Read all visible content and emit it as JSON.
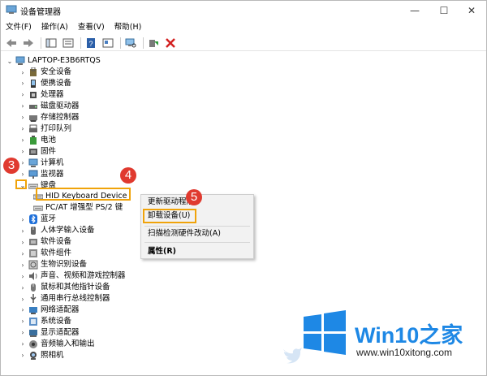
{
  "window": {
    "title": "设备管理器",
    "minimize": "—",
    "maximize": "☐",
    "close": "✕"
  },
  "menu": [
    "文件(F)",
    "操作(A)",
    "查看(V)",
    "帮助(H)"
  ],
  "tree": {
    "root": "LAPTOP-E3B6RTQS",
    "items": [
      {
        "label": "安全设备",
        "icon": "security-icon",
        "expanded": false
      },
      {
        "label": "便携设备",
        "icon": "portable-device-icon",
        "expanded": false
      },
      {
        "label": "处理器",
        "icon": "processor-icon",
        "expanded": false
      },
      {
        "label": "磁盘驱动器",
        "icon": "disk-icon",
        "expanded": false
      },
      {
        "label": "存储控制器",
        "icon": "storage-controller-icon",
        "expanded": false
      },
      {
        "label": "打印队列",
        "icon": "printer-icon",
        "expanded": false
      },
      {
        "label": "电池",
        "icon": "battery-icon",
        "expanded": false
      },
      {
        "label": "固件",
        "icon": "firmware-icon",
        "expanded": false
      },
      {
        "label": "计算机",
        "icon": "computer-icon",
        "expanded": false
      },
      {
        "label": "监视器",
        "icon": "monitor-icon",
        "expanded": false
      },
      {
        "label": "键盘",
        "icon": "keyboard-icon",
        "expanded": true
      },
      {
        "label": "HID Keyboard Device",
        "icon": "keyboard-icon",
        "child": true,
        "selected": true
      },
      {
        "label": "PC/AT 增强型 PS/2 键",
        "icon": "keyboard-icon",
        "child": true
      },
      {
        "label": "蓝牙",
        "icon": "bluetooth-icon",
        "expanded": false
      },
      {
        "label": "人体学输入设备",
        "icon": "hid-icon",
        "expanded": false
      },
      {
        "label": "软件设备",
        "icon": "software-device-icon",
        "expanded": false
      },
      {
        "label": "软件组件",
        "icon": "software-component-icon",
        "expanded": false
      },
      {
        "label": "生物识别设备",
        "icon": "biometric-icon",
        "expanded": false
      },
      {
        "label": "声音、视频和游戏控制器",
        "icon": "sound-icon",
        "expanded": false
      },
      {
        "label": "鼠标和其他指针设备",
        "icon": "mouse-icon",
        "expanded": false
      },
      {
        "label": "通用串行总线控制器",
        "icon": "usb-icon",
        "expanded": false
      },
      {
        "label": "网络适配器",
        "icon": "network-icon",
        "expanded": false
      },
      {
        "label": "系统设备",
        "icon": "system-device-icon",
        "expanded": false
      },
      {
        "label": "显示适配器",
        "icon": "display-adapter-icon",
        "expanded": false
      },
      {
        "label": "音频输入和输出",
        "icon": "audio-icon",
        "expanded": false
      },
      {
        "label": "照相机",
        "icon": "camera-icon",
        "expanded": false
      }
    ]
  },
  "context_menu": {
    "items": [
      "更新驱动程序",
      "卸载设备(U)",
      "扫描检测硬件改动(A)",
      "属性(R)"
    ]
  },
  "steps": [
    "3",
    "4",
    "5"
  ],
  "watermark": {
    "brand": "Win10",
    "suffix": "之家",
    "url": "www.win10xitong.com"
  },
  "colors": {
    "highlight": "#f0a30a",
    "step_badge": "#e03a2f",
    "win_blue": "#1e88e5"
  }
}
